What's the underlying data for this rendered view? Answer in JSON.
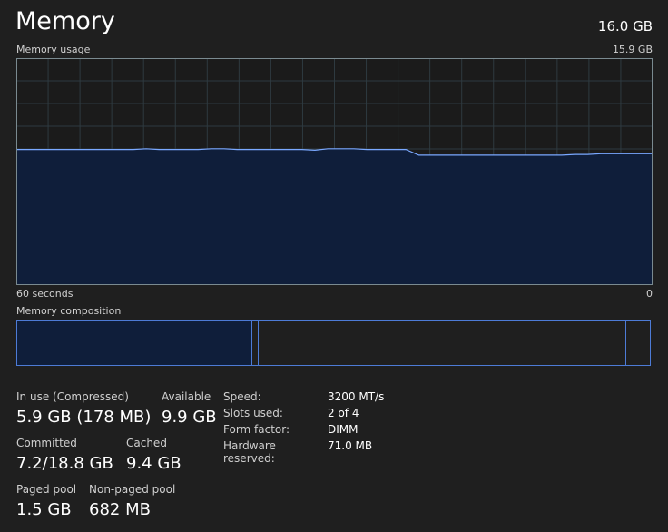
{
  "header": {
    "title": "Memory",
    "total": "16.0 GB"
  },
  "graph": {
    "label": "Memory usage",
    "max_label": "15.9 GB",
    "time_label": "60 seconds",
    "zero_label": "0",
    "line_color": "#7aa8ff",
    "fill_color": "#0f1e3a",
    "grid_color": "#2e3a40",
    "usage_gb": [
      9.5,
      9.5,
      9.5,
      9.5,
      9.5,
      9.5,
      9.5,
      9.5,
      9.5,
      9.5,
      9.55,
      9.5,
      9.5,
      9.5,
      9.5,
      9.55,
      9.55,
      9.5,
      9.5,
      9.5,
      9.5,
      9.5,
      9.5,
      9.45,
      9.55,
      9.55,
      9.55,
      9.5,
      9.5,
      9.5,
      9.5,
      9.1,
      9.1,
      9.1,
      9.1,
      9.1,
      9.1,
      9.1,
      9.1,
      9.1,
      9.1,
      9.1,
      9.1,
      9.15,
      9.15,
      9.2,
      9.2,
      9.2,
      9.2,
      9.2
    ]
  },
  "composition": {
    "label": "Memory composition",
    "in_use_fraction": 0.371,
    "modified_fraction": 0.01,
    "standby_fraction": 0.582,
    "border_color": "#4d7bd6"
  },
  "stats": {
    "in_use_label": "In use (Compressed)",
    "in_use_value": "5.9 GB (178 MB)",
    "available_label": "Available",
    "available_value": "9.9 GB",
    "committed_label": "Committed",
    "committed_value": "7.2/18.8 GB",
    "cached_label": "Cached",
    "cached_value": "9.4 GB",
    "paged_label": "Paged pool",
    "paged_value": "1.5 GB",
    "nonpaged_label": "Non-paged pool",
    "nonpaged_value": "682 MB"
  },
  "specs": {
    "speed_label": "Speed:",
    "speed_value": "3200 MT/s",
    "slots_label": "Slots used:",
    "slots_value": "2 of 4",
    "form_label": "Form factor:",
    "form_value": "DIMM",
    "reserved_label": "Hardware reserved:",
    "reserved_value": "71.0 MB"
  }
}
